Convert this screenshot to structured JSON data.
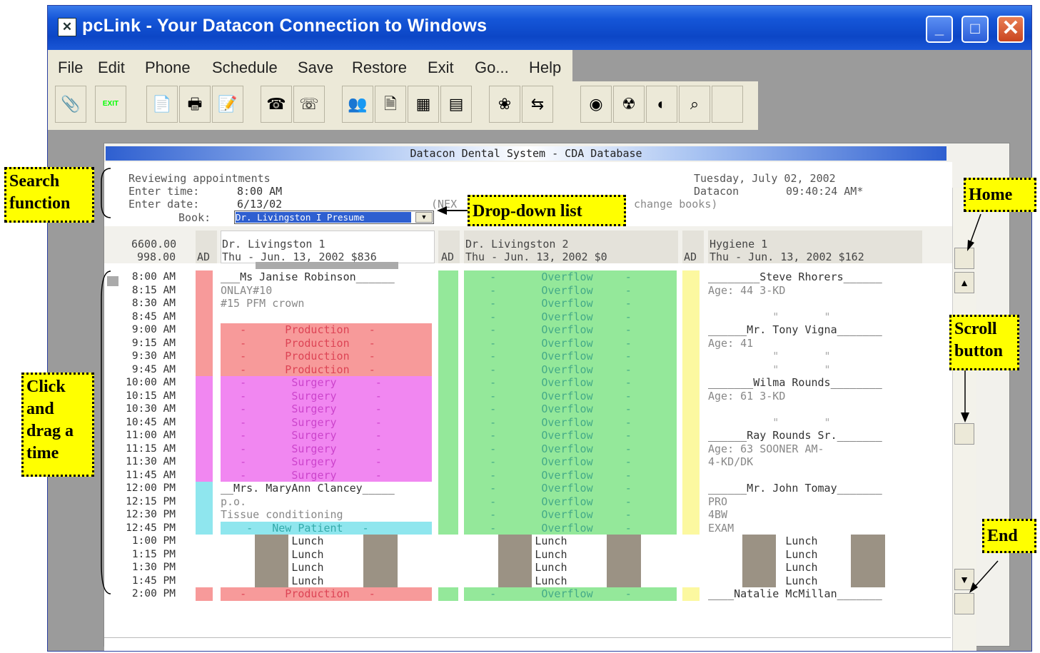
{
  "window": {
    "title": "pcLink - Your Datacon Connection to Windows",
    "minimize": "_",
    "maximize": "□",
    "close": "✕"
  },
  "menu": [
    "File",
    "Edit",
    "Phone",
    "Schedule",
    "Save",
    "Restore",
    "Exit",
    "Go...",
    "Help"
  ],
  "toolbar": [
    {
      "icon": "paperclip-icon",
      "glyph": "📎"
    },
    {
      "icon": "exit-icon",
      "glyph": "EXIT"
    },
    {
      "icon": "new-document-icon",
      "glyph": "📄"
    },
    {
      "icon": "printer-icon",
      "glyph": "🖶"
    },
    {
      "icon": "note-icon",
      "glyph": "📝"
    },
    {
      "icon": "phone-icon",
      "glyph": "☎"
    },
    {
      "icon": "phone-hangup-icon",
      "glyph": "☏"
    },
    {
      "icon": "people-icon",
      "glyph": "👥"
    },
    {
      "icon": "form-icon",
      "glyph": "🗎"
    },
    {
      "icon": "chart-icon",
      "glyph": "▦"
    },
    {
      "icon": "calendar-icon",
      "glyph": "▤"
    },
    {
      "icon": "dental-icon",
      "glyph": "❀"
    },
    {
      "icon": "arrows-icon",
      "glyph": "⇆"
    },
    {
      "icon": "eye-icon",
      "glyph": "◉"
    },
    {
      "icon": "radiation-icon",
      "glyph": "☢"
    },
    {
      "icon": "globe-icon",
      "glyph": "◐"
    },
    {
      "icon": "search-icon",
      "glyph": "⌕"
    },
    {
      "icon": "blank-icon",
      "glyph": ""
    }
  ],
  "inner_title": "Datacon Dental System  - CDA Database",
  "search": {
    "line1": "Reviewing appointments",
    "time_label": "Enter time:",
    "time_value": "8:00 AM",
    "date_label": "Enter date:",
    "date_value": "6/13/02",
    "book_label": "Book:",
    "book_value": "Dr. Livingston I Presume",
    "hint": "(NEX",
    "hint2": "change books)"
  },
  "header_right": {
    "date": "Tuesday, July 02, 2002",
    "org": "Datacon",
    "clock": "09:40:24 AM*"
  },
  "totals": [
    "6600.00",
    "998.00"
  ],
  "ad_label": "AD",
  "columns": [
    {
      "name": "Dr. Livingston 1",
      "date": "Thu - Jun. 13, 2002 $836"
    },
    {
      "name": "Dr. Livingston 2",
      "date": "Thu - Jun. 13, 2002 $0"
    },
    {
      "name": "Hygiene 1",
      "date": "Thu - Jun. 13, 2002 $162"
    }
  ],
  "times": [
    "8:00 AM",
    "8:15 AM",
    "8:30 AM",
    "8:45 AM",
    "9:00 AM",
    "9:15 AM",
    "9:30 AM",
    "9:45 AM",
    "10:00 AM",
    "10:15 AM",
    "10:30 AM",
    "10:45 AM",
    "11:00 AM",
    "11:15 AM",
    "11:30 AM",
    "11:45 AM",
    "12:00 PM",
    "12:15 PM",
    "12:30 PM",
    "12:45 PM",
    "1:00 PM",
    "1:15 PM",
    "1:30 PM",
    "1:45 PM",
    "2:00 PM"
  ],
  "col1": [
    {
      "t": "___Ms Janise Robinson______",
      "bg": "#ffffff",
      "c": "#333",
      "ad": "#f79a9a"
    },
    {
      "t": "ONLAY#10",
      "bg": "#ffffff",
      "c": "#888",
      "ad": "#f79a9a"
    },
    {
      "t": "#15 PFM crown",
      "bg": "#ffffff",
      "c": "#888",
      "ad": "#f79a9a"
    },
    {
      "t": "",
      "bg": "#ffffff",
      "c": "#888",
      "ad": "#f79a9a"
    },
    {
      "t": "   -      Production   -",
      "bg": "#f79a9a",
      "c": "#d45",
      "ad": "#f79a9a"
    },
    {
      "t": "   -      Production   -",
      "bg": "#f79a9a",
      "c": "#d45",
      "ad": "#f79a9a"
    },
    {
      "t": "   -      Production   -",
      "bg": "#f79a9a",
      "c": "#d45",
      "ad": "#f79a9a"
    },
    {
      "t": "   -      Production   -",
      "bg": "#f79a9a",
      "c": "#d45",
      "ad": "#f79a9a"
    },
    {
      "t": "   -       Surgery      -",
      "bg": "#f187f1",
      "c": "#c4c",
      "ad": "#f187f1"
    },
    {
      "t": "   -       Surgery      -",
      "bg": "#f187f1",
      "c": "#c4c",
      "ad": "#f187f1"
    },
    {
      "t": "   -       Surgery      -",
      "bg": "#f187f1",
      "c": "#c4c",
      "ad": "#f187f1"
    },
    {
      "t": "   -       Surgery      -",
      "bg": "#f187f1",
      "c": "#c4c",
      "ad": "#f187f1"
    },
    {
      "t": "   -       Surgery      -",
      "bg": "#f187f1",
      "c": "#c4c",
      "ad": "#f187f1"
    },
    {
      "t": "   -       Surgery      -",
      "bg": "#f187f1",
      "c": "#c4c",
      "ad": "#f187f1"
    },
    {
      "t": "   -       Surgery      -",
      "bg": "#f187f1",
      "c": "#c4c",
      "ad": "#f187f1"
    },
    {
      "t": "   -       Surgery      -",
      "bg": "#f187f1",
      "c": "#c4c",
      "ad": "#f187f1"
    },
    {
      "t": "__Mrs. MaryAnn Clancey_____",
      "bg": "#ffffff",
      "c": "#333",
      "ad": "#8fe6ee"
    },
    {
      "t": "p.o.",
      "bg": "#ffffff",
      "c": "#888",
      "ad": "#8fe6ee"
    },
    {
      "t": "Tissue conditioning",
      "bg": "#ffffff",
      "c": "#888",
      "ad": "#8fe6ee"
    },
    {
      "t": "    -   New Patient   -",
      "bg": "#8fe6ee",
      "c": "#3aa",
      "ad": "#8fe6ee"
    },
    {
      "t": "           Lunch",
      "bg": "lunch",
      "c": "#333",
      "ad": "#ffffff"
    },
    {
      "t": "           Lunch",
      "bg": "lunch",
      "c": "#333",
      "ad": "#ffffff"
    },
    {
      "t": "           Lunch",
      "bg": "lunch",
      "c": "#333",
      "ad": "#ffffff"
    },
    {
      "t": "           Lunch",
      "bg": "lunch",
      "c": "#333",
      "ad": "#ffffff"
    },
    {
      "t": "   -      Production   -",
      "bg": "#f79a9a",
      "c": "#d45",
      "ad": "#f79a9a"
    }
  ],
  "col2_overflow": "    -       Overflow     -",
  "col2_lunch": "           Lunch",
  "col3": [
    {
      "t": "________Steve Rhorers______",
      "c": "#333"
    },
    {
      "t": "Age: 44 3-KD",
      "c": "#888"
    },
    {
      "t": "",
      "c": "#888"
    },
    {
      "t": "          \"       \"",
      "c": "#aaa"
    },
    {
      "t": "______Mr. Tony Vigna_______",
      "c": "#333"
    },
    {
      "t": "Age: 41",
      "c": "#888"
    },
    {
      "t": "          \"       \"",
      "c": "#aaa"
    },
    {
      "t": "          \"       \"",
      "c": "#aaa"
    },
    {
      "t": "_______Wilma Rounds________",
      "c": "#333"
    },
    {
      "t": "Age: 61 3-KD",
      "c": "#888"
    },
    {
      "t": "",
      "c": "#888"
    },
    {
      "t": "          \"       \"",
      "c": "#aaa"
    },
    {
      "t": "______Ray Rounds Sr._______",
      "c": "#333"
    },
    {
      "t": "Age: 63 SOONER AM-",
      "c": "#888"
    },
    {
      "t": "4-KD/DK",
      "c": "#888"
    },
    {
      "t": "",
      "c": "#888"
    },
    {
      "t": "______Mr. John Tomay_______",
      "c": "#333"
    },
    {
      "t": "PRO",
      "c": "#888"
    },
    {
      "t": "4BW",
      "c": "#888"
    },
    {
      "t": "EXAM",
      "c": "#888"
    },
    {
      "t": "            Lunch",
      "c": "#333",
      "lunch": true
    },
    {
      "t": "            Lunch",
      "c": "#333",
      "lunch": true
    },
    {
      "t": "            Lunch",
      "c": "#333",
      "lunch": true
    },
    {
      "t": "            Lunch",
      "c": "#333",
      "lunch": true
    },
    {
      "t": "____Natalie McMillan_______",
      "c": "#333"
    }
  ],
  "callouts": {
    "search": "Search function",
    "dropdown": "Drop-down list",
    "home": "Home",
    "scroll": "Scroll button",
    "drag": "Click and drag a time",
    "end": "End"
  },
  "colors": {
    "title_blue": "#0c46c6",
    "callout_yellow": "#ffff00",
    "overflow_green": "#94e89a",
    "hygiene_ad": "#fcf8a0"
  }
}
